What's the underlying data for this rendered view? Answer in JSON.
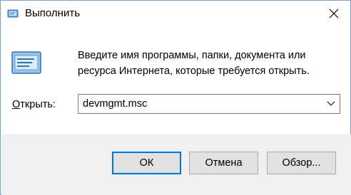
{
  "window": {
    "title": "Выполнить",
    "close_icon": "close-icon"
  },
  "dialog": {
    "description_line1": "Введите имя программы, папки, документа или",
    "description_line2": "ресурса Интернета, которые требуется открыть.",
    "open_label_mnemonic": "О",
    "open_label_rest": "ткрыть:",
    "input_value": "devmgmt.msc"
  },
  "buttons": {
    "ok": "ОК",
    "cancel": "Отмена",
    "browse": "Обзор..."
  },
  "colors": {
    "accent": "#0078d7",
    "footer": "#f0f0f0",
    "button_bg": "#e1e1e1"
  }
}
